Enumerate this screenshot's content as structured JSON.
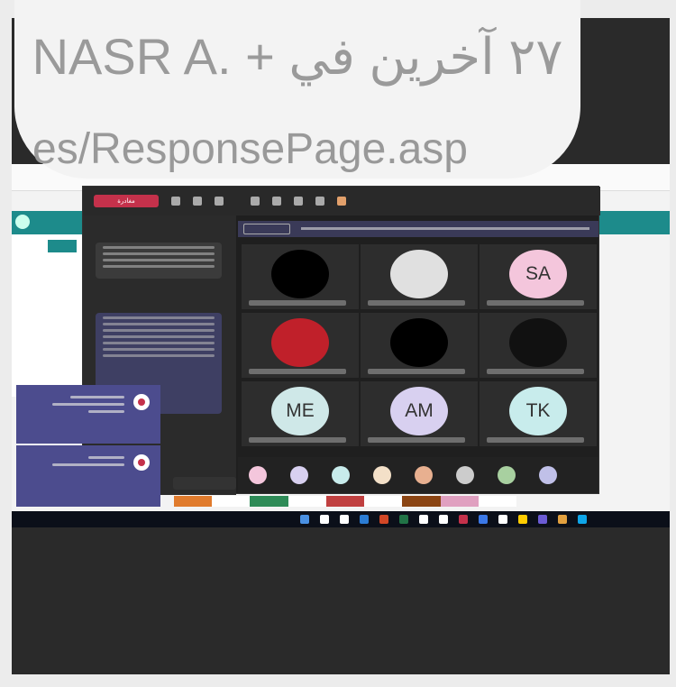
{
  "overlay": {
    "title": "NASR A. + ٢٧ آخرين في",
    "url": "es/ResponsePage.asp"
  },
  "teams": {
    "leave_label": "مغادرة",
    "participants": [
      {
        "initials": "SA",
        "color": "#f4c6dc"
      },
      {
        "initials": "",
        "color": "#e0e0e0"
      },
      {
        "initials": "",
        "color": "#000000"
      },
      {
        "initials": "",
        "color": "#111111"
      },
      {
        "initials": "",
        "color": "#000000"
      },
      {
        "initials": "",
        "color": "#c0202a"
      },
      {
        "initials": "TK",
        "color": "#c8ecec"
      },
      {
        "initials": "AM",
        "color": "#d8d0f0"
      },
      {
        "initials": "ME",
        "color": "#cfe8e8"
      }
    ],
    "strip_colors": [
      "#f4c6dc",
      "#d8d0f0",
      "#c8ecec",
      "#f3e0c8",
      "#e8b090",
      "#ccc",
      "#a8d0a0",
      "#c0c0e8"
    ]
  },
  "colors": {
    "teams_bg": "#1f1f1f",
    "accent": "#4c4c8e",
    "teal": "#1d8b8b"
  }
}
